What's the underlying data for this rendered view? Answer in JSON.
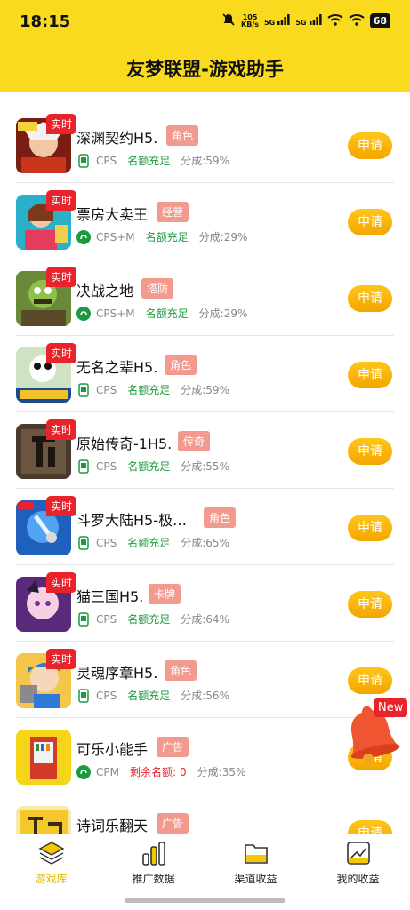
{
  "status_bar": {
    "time": "18:15",
    "net_speed_value": "105",
    "net_speed_unit": "KB/s",
    "signal_1": "5G",
    "signal_2": "5G",
    "battery": "68",
    "icons": [
      "mute-bell-icon",
      "signal-icon",
      "signal-icon",
      "wifi-icon",
      "wifi-icon",
      "battery-icon"
    ]
  },
  "header": {
    "title": "友梦联盟-游戏助手",
    "color": "#f9da1f"
  },
  "list": {
    "live_label": "实时",
    "apply_label": "申请",
    "items": [
      {
        "name": "深渊契约H5.",
        "category": "角色",
        "channel": "CPS",
        "status": "名额充足",
        "share": "分成:59%",
        "live": true
      },
      {
        "name": "票房大卖王",
        "category": "经营",
        "channel": "CPS+M",
        "status": "名额充足",
        "share": "分成:29%",
        "live": true
      },
      {
        "name": "决战之地",
        "category": "塔防",
        "channel": "CPS+M",
        "status": "名额充足",
        "share": "分成:29%",
        "live": true
      },
      {
        "name": "无名之辈H5.",
        "category": "角色",
        "channel": "CPS",
        "status": "名额充足",
        "share": "分成:59%",
        "live": true
      },
      {
        "name": "原始传奇-1H5.",
        "category": "传奇",
        "channel": "CPS",
        "status": "名额充足",
        "share": "分成:55%",
        "live": true
      },
      {
        "name": "斗罗大陆H5-极…",
        "category": "角色",
        "channel": "CPS",
        "status": "名额充足",
        "share": "分成:65%",
        "live": true
      },
      {
        "name": "猫三国H5.",
        "category": "卡牌",
        "channel": "CPS",
        "status": "名额充足",
        "share": "分成:64%",
        "live": true
      },
      {
        "name": "灵魂序章H5.",
        "category": "角色",
        "channel": "CPS",
        "status": "名额充足",
        "share": "分成:56%",
        "live": true
      },
      {
        "name": "可乐小能手",
        "category": "广告",
        "channel": "CPM",
        "quota_label": "剩余名额:",
        "quota_value": "0",
        "share": "分成:35%",
        "live": false
      },
      {
        "name": "诗词乐翻天",
        "category": "广告",
        "channel": "",
        "status": "",
        "share": "",
        "live": false
      }
    ]
  },
  "float_badge": {
    "label": "New",
    "icon": "bell-icon"
  },
  "tabbar": {
    "tabs": [
      {
        "label": "游戏库",
        "icon": "stack-icon",
        "active": true
      },
      {
        "label": "推广数据",
        "icon": "bar-chart-icon",
        "active": false
      },
      {
        "label": "渠道收益",
        "icon": "folder-icon",
        "active": false
      },
      {
        "label": "我的收益",
        "icon": "trend-icon",
        "active": false
      }
    ]
  },
  "colors": {
    "accent": "#f9da1f",
    "live_red": "#e8232b",
    "apply_orange": "#f3a500",
    "status_green": "#1c9a3f",
    "category_pink": "#f39a8f"
  }
}
